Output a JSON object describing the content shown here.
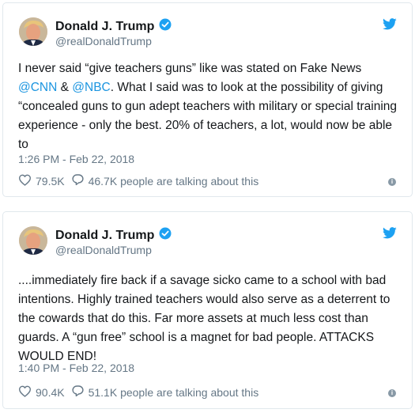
{
  "colors": {
    "accent": "#1b95e0",
    "muted": "#657786",
    "text": "#14171a",
    "border": "#e1e8ed"
  },
  "tweets": [
    {
      "name": "Donald J. Trump",
      "handle": "@realDonaldTrump",
      "text_parts": [
        "I never said “give teachers guns” like was stated on Fake News ",
        "@CNN",
        " & ",
        "@NBC",
        ". What I said was to look at the possibility of giving “concealed guns to gun adept teachers with military or special training experience - only the best. 20% of teachers, a lot, would now be able to"
      ],
      "timestamp": "1:26 PM - Feb 22, 2018",
      "likes": "79.5K",
      "talking": "46.7K people are talking about this",
      "icons": [
        "avatar",
        "verified-badge-icon",
        "twitter-bird-icon",
        "heart-icon",
        "reply-bubble-icon",
        "info-icon"
      ]
    },
    {
      "name": "Donald J. Trump",
      "handle": "@realDonaldTrump",
      "text": "....immediately fire back if a savage sicko came to a school with bad intentions. Highly trained teachers would also serve as a deterrent to the cowards that do this. Far more assets at much less cost than guards. A “gun free” school is a magnet for bad people. ATTACKS WOULD END!",
      "timestamp": "1:40 PM - Feb 22, 2018",
      "likes": "90.4K",
      "talking": "51.1K people are talking about this",
      "icons": [
        "avatar",
        "verified-badge-icon",
        "twitter-bird-icon",
        "heart-icon",
        "reply-bubble-icon",
        "info-icon"
      ]
    }
  ]
}
